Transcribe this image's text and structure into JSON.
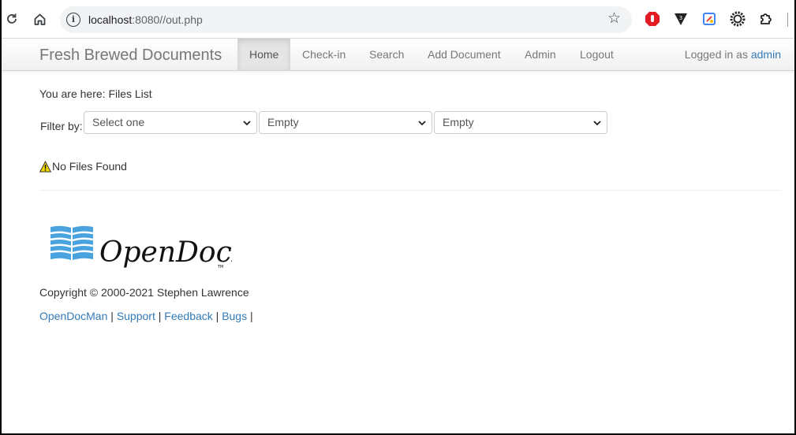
{
  "browser": {
    "url_host": "localhost",
    "url_rest": ":8080//out.php"
  },
  "navbar": {
    "brand": "Fresh Brewed Documents",
    "items": [
      {
        "label": "Home",
        "active": true
      },
      {
        "label": "Check-in"
      },
      {
        "label": "Search"
      },
      {
        "label": "Add Document"
      },
      {
        "label": "Admin"
      },
      {
        "label": "Logout"
      }
    ],
    "logged_in_prefix": "Logged in as",
    "user": "admin"
  },
  "breadcrumb": "You are here: Files List",
  "filter": {
    "label": "Filter by:",
    "selects": [
      {
        "value": "Select one"
      },
      {
        "value": "Empty"
      },
      {
        "value": "Empty"
      }
    ]
  },
  "message": "No Files Found",
  "footer": {
    "logo_text": "OpenDocMan",
    "logo_tm": "TM",
    "copyright": "Copyright © 2000-2021 Stephen Lawrence",
    "links": [
      "OpenDocMan",
      "Support",
      "Feedback",
      "Bugs"
    ],
    "separator": "|"
  },
  "colors": {
    "link": "#337ab7",
    "logo_blue": "#4aa3df",
    "warning_yellow": "#f5d800"
  }
}
